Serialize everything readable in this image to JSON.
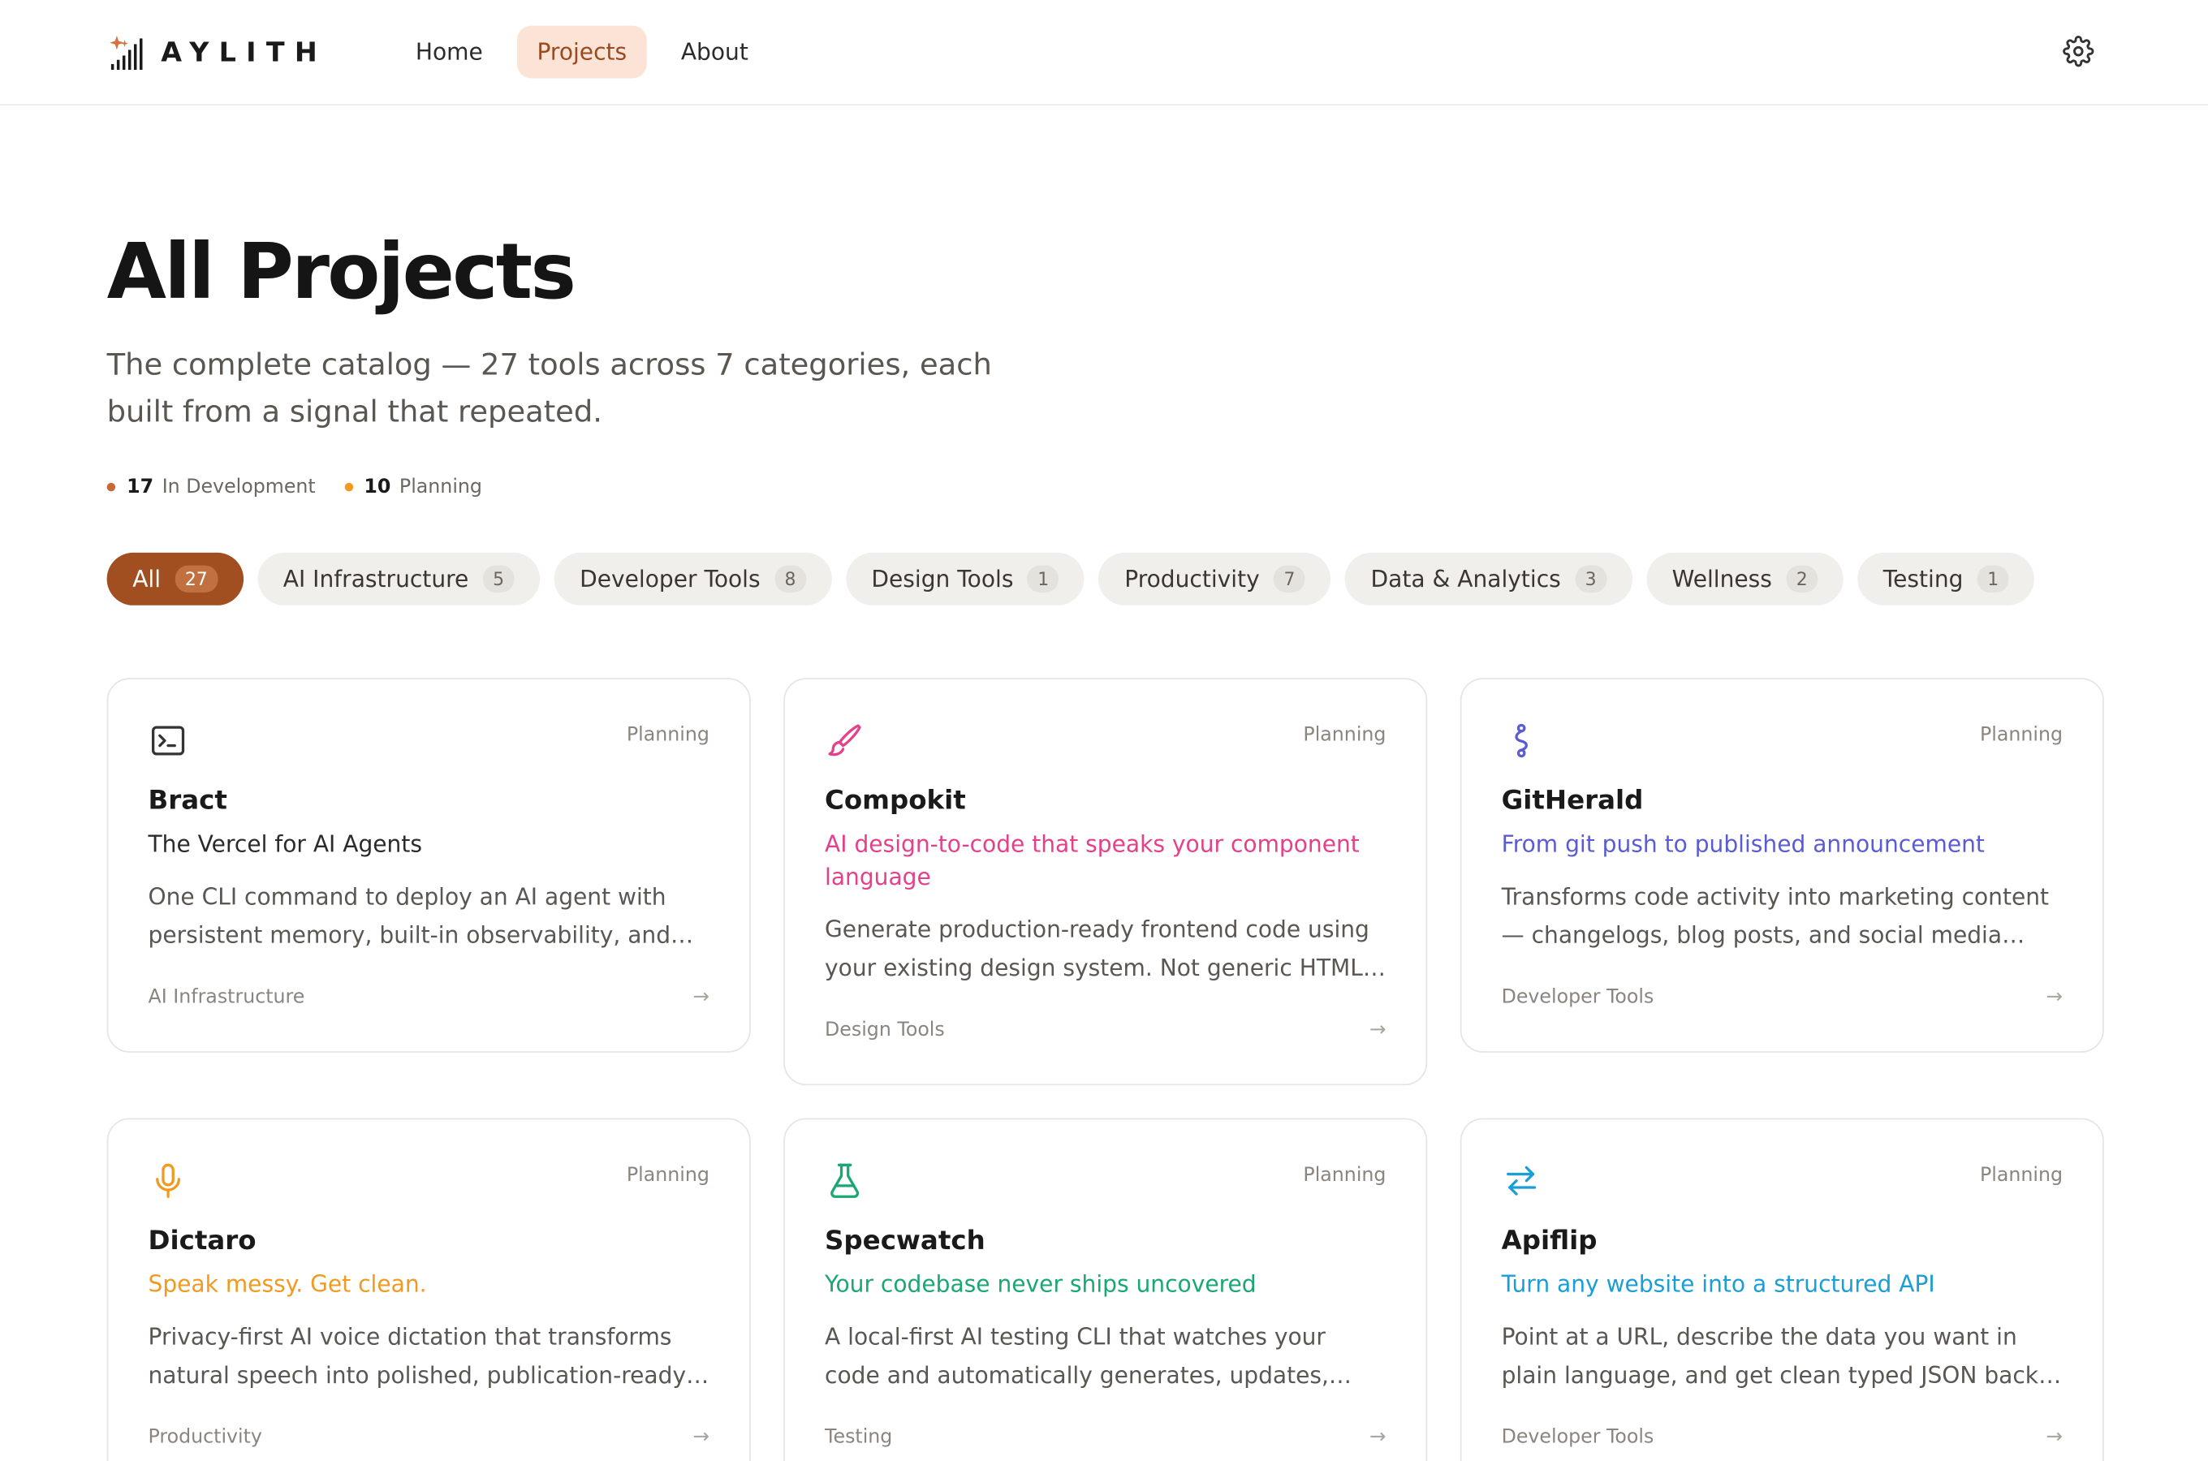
{
  "brand": {
    "name": "AYLITH"
  },
  "nav": {
    "links": [
      {
        "label": "Home",
        "active": false
      },
      {
        "label": "Projects",
        "active": true
      },
      {
        "label": "About",
        "active": false
      }
    ]
  },
  "hero": {
    "title": "All Projects",
    "subtitle": "The complete catalog — 27 tools across 7 categories, each built from a signal that repeated.",
    "stats": [
      {
        "count": "17",
        "label": "In Development",
        "color": "#c66a3a"
      },
      {
        "count": "10",
        "label": "Planning",
        "color": "#f29a1f"
      }
    ]
  },
  "filters": [
    {
      "label": "All",
      "count": "27",
      "active": true
    },
    {
      "label": "AI Infrastructure",
      "count": "5"
    },
    {
      "label": "Developer Tools",
      "count": "8"
    },
    {
      "label": "Design Tools",
      "count": "1"
    },
    {
      "label": "Productivity",
      "count": "7"
    },
    {
      "label": "Data & Analytics",
      "count": "3"
    },
    {
      "label": "Wellness",
      "count": "2"
    },
    {
      "label": "Testing",
      "count": "1"
    }
  ],
  "projects": [
    {
      "name": "Bract",
      "status": "Planning",
      "tagline": "The Vercel for AI Agents",
      "tagline_color": "#2b2b2b",
      "icon": "terminal-icon",
      "icon_color": "#333333",
      "description": "One CLI command to deploy an AI agent with persistent memory, built-in observability, and…",
      "category": "AI Infrastructure"
    },
    {
      "name": "Compokit",
      "status": "Planning",
      "tagline": "AI design-to-code that speaks your component language",
      "tagline_color": "#e5408a",
      "icon": "paintbrush-icon",
      "icon_color": "#e5408a",
      "description": "Generate production-ready frontend code using your existing design system. Not generic HTML —…",
      "category": "Design Tools"
    },
    {
      "name": "GitHerald",
      "status": "Planning",
      "tagline": "From git push to published announcement",
      "tagline_color": "#5b5bd6",
      "icon": "git-branch-icon",
      "icon_color": "#5b5bd6",
      "description": "Transforms code activity into marketing content — changelogs, blog posts, and social media updates…",
      "category": "Developer Tools"
    },
    {
      "name": "Dictaro",
      "status": "Planning",
      "tagline": "Speak messy. Get clean.",
      "tagline_color": "#f29a1f",
      "icon": "microphone-icon",
      "icon_color": "#f29a1f",
      "description": "Privacy-first AI voice dictation that transforms natural speech into polished, publication-ready tex…",
      "category": "Productivity"
    },
    {
      "name": "Specwatch",
      "status": "Planning",
      "tagline": "Your codebase never ships uncovered",
      "tagline_color": "#1aa872",
      "icon": "flask-icon",
      "icon_color": "#1aa872",
      "description": "A local-first AI testing CLI that watches your code and automatically generates, updates, and…",
      "category": "Testing"
    },
    {
      "name": "Apiflip",
      "status": "Planning",
      "tagline": "Turn any website into a structured API",
      "tagline_color": "#1a9ed8",
      "icon": "swap-arrows-icon",
      "icon_color": "#1a9ed8",
      "description": "Point at a URL, describe the data you want in plain language, and get clean typed JSON back — even…",
      "category": "Developer Tools"
    }
  ],
  "icons": {
    "settings": "gear-icon",
    "card_arrow": "→"
  }
}
